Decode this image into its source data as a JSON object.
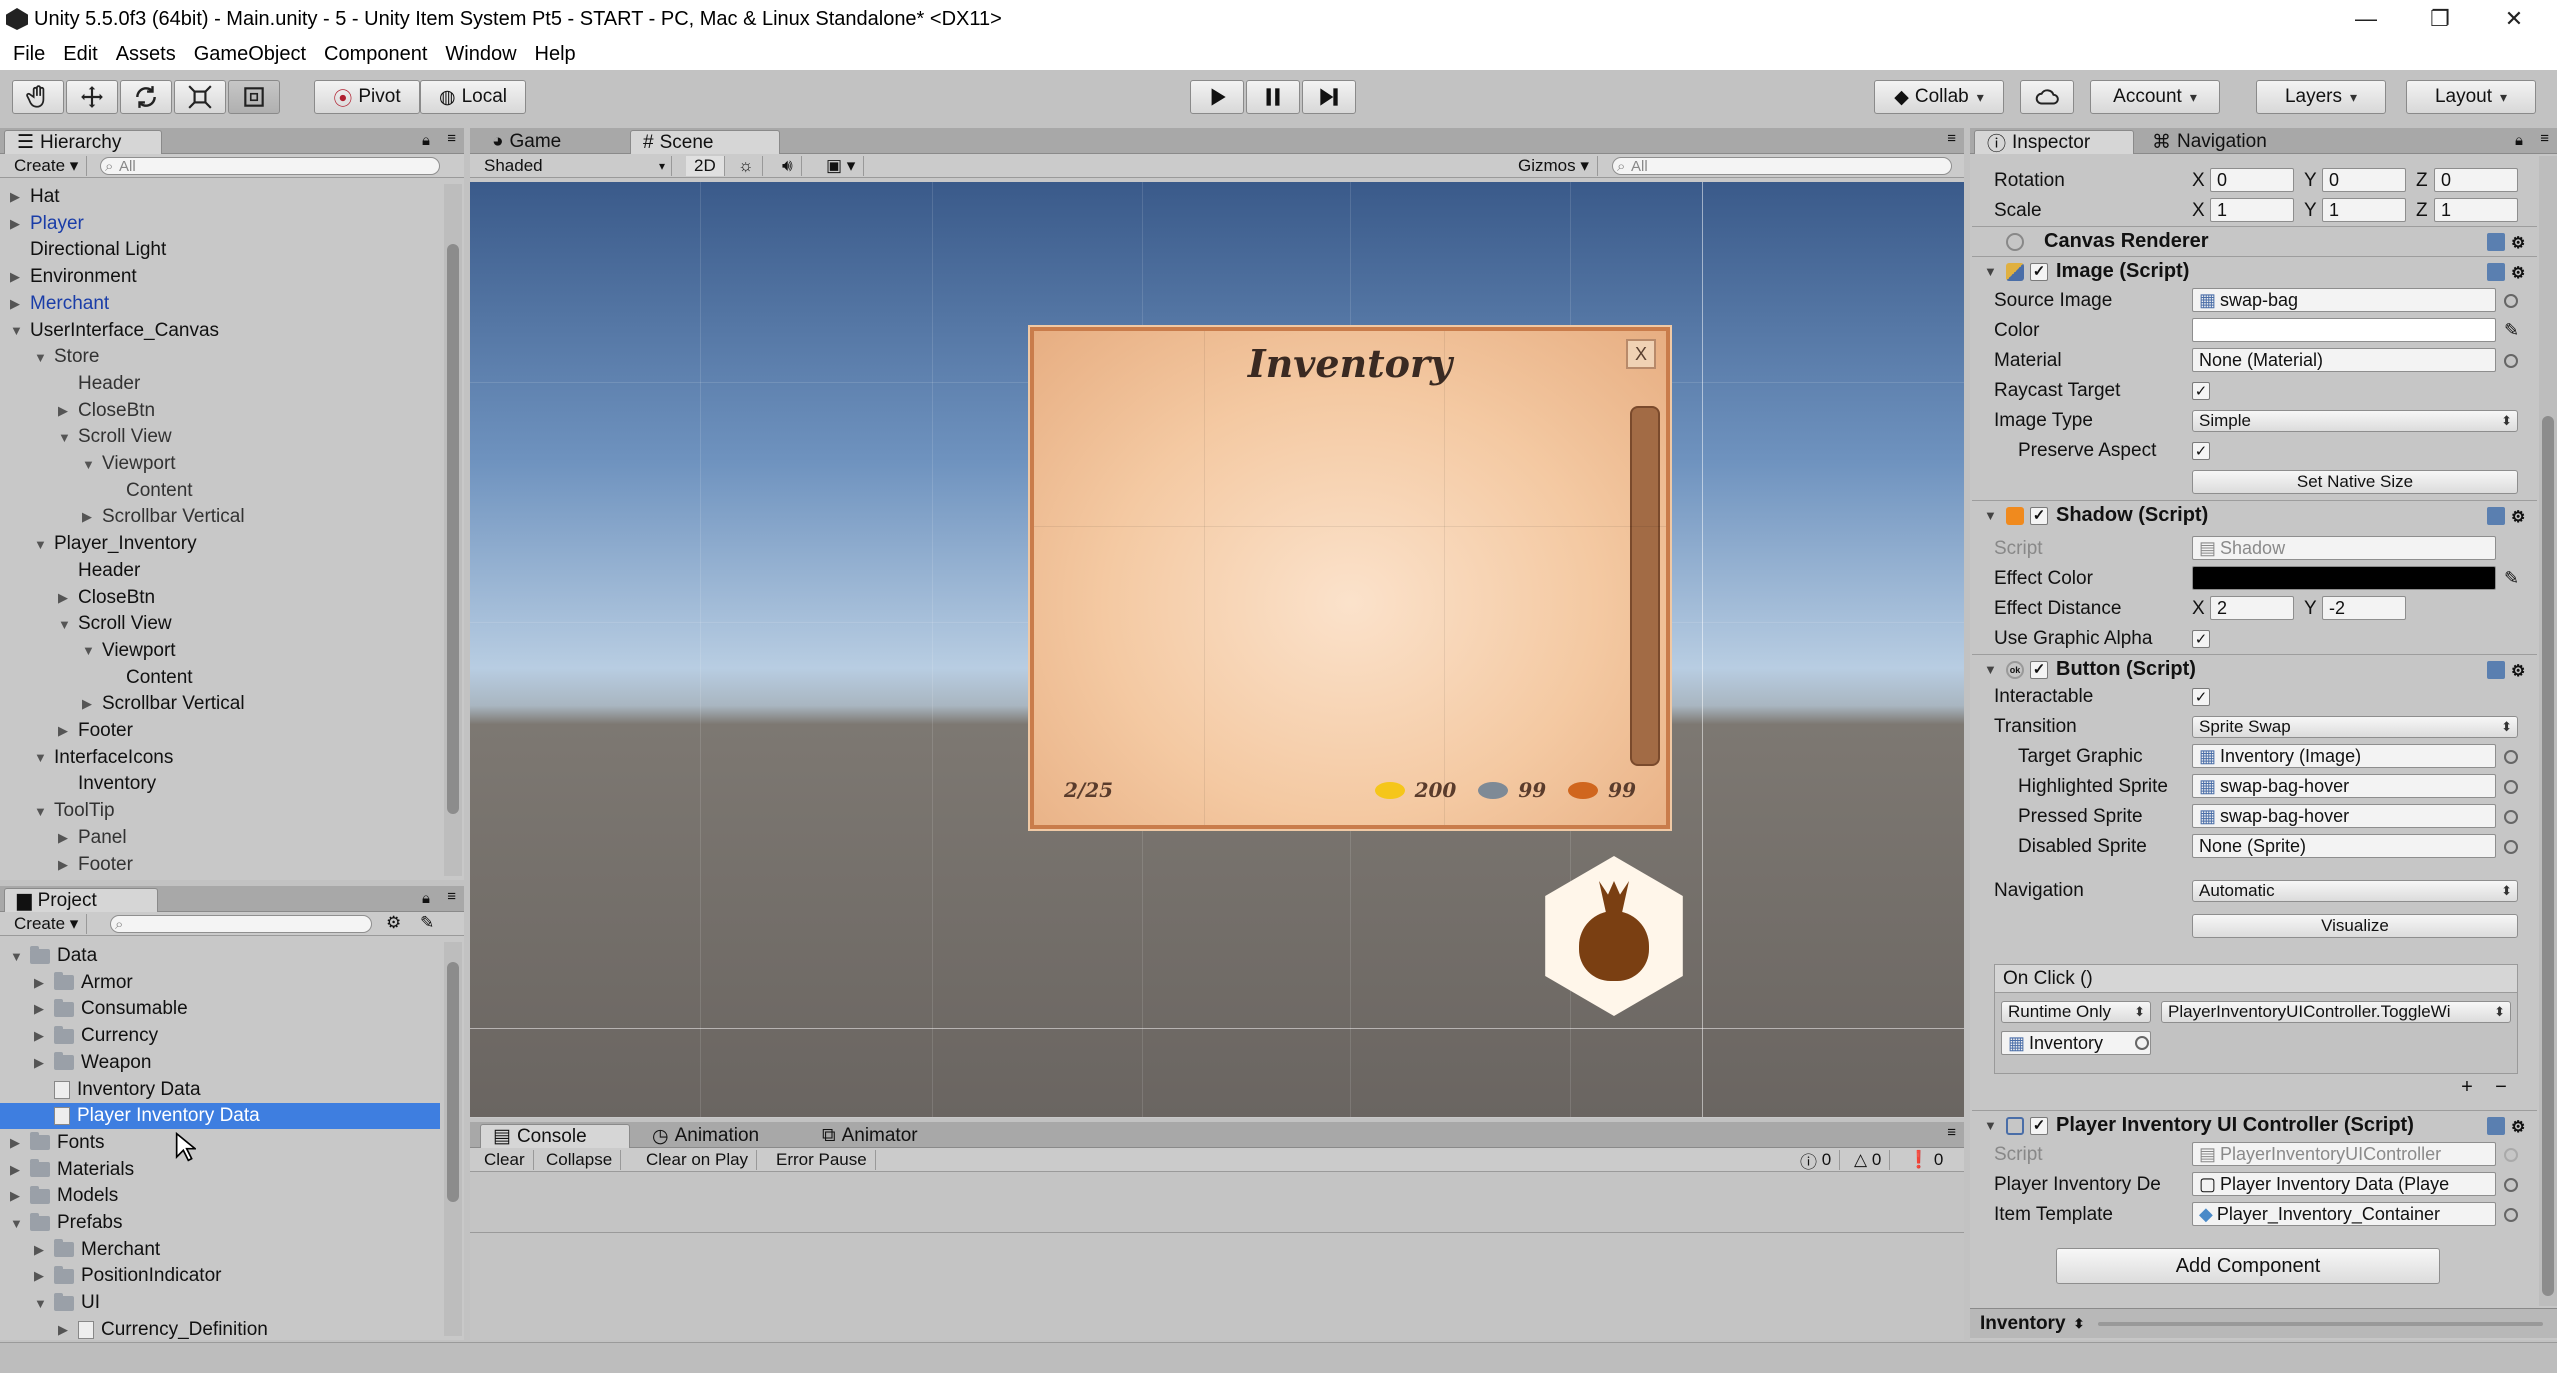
{
  "titlebar": {
    "title": "Unity 5.5.0f3 (64bit) - Main.unity - 5 - Unity Item System Pt5 - START - PC, Mac & Linux Standalone* <DX11>"
  },
  "menu": [
    "File",
    "Edit",
    "Assets",
    "GameObject",
    "Component",
    "Window",
    "Help"
  ],
  "toolbar": {
    "pivot": "Pivot",
    "local": "Local",
    "collab": "Collab",
    "account": "Account",
    "layers": "Layers",
    "layout": "Layout"
  },
  "hierarchy": {
    "tab": "Hierarchy",
    "create": "Create",
    "search": "All",
    "items": [
      {
        "label": "Hat",
        "indent": 0,
        "arrow": "right",
        "color": "black"
      },
      {
        "label": "Player",
        "indent": 0,
        "arrow": "right",
        "color": "blue"
      },
      {
        "label": "Directional Light",
        "indent": 0,
        "arrow": "",
        "color": "black"
      },
      {
        "label": "Environment",
        "indent": 0,
        "arrow": "right",
        "color": "black"
      },
      {
        "label": "Merchant",
        "indent": 0,
        "arrow": "right",
        "color": "blue"
      },
      {
        "label": "UserInterface_Canvas",
        "indent": 0,
        "arrow": "down",
        "color": "black"
      },
      {
        "label": "Store",
        "indent": 1,
        "arrow": "down",
        "color": "grey"
      },
      {
        "label": "Header",
        "indent": 2,
        "arrow": "",
        "color": "grey"
      },
      {
        "label": "CloseBtn",
        "indent": 2,
        "arrow": "right",
        "color": "grey"
      },
      {
        "label": "Scroll View",
        "indent": 2,
        "arrow": "down",
        "color": "grey"
      },
      {
        "label": "Viewport",
        "indent": 3,
        "arrow": "down",
        "color": "grey"
      },
      {
        "label": "Content",
        "indent": 4,
        "arrow": "",
        "color": "grey"
      },
      {
        "label": "Scrollbar Vertical",
        "indent": 3,
        "arrow": "right",
        "color": "grey"
      },
      {
        "label": "Player_Inventory",
        "indent": 1,
        "arrow": "down",
        "color": "black"
      },
      {
        "label": "Header",
        "indent": 2,
        "arrow": "",
        "color": "black"
      },
      {
        "label": "CloseBtn",
        "indent": 2,
        "arrow": "right",
        "color": "black"
      },
      {
        "label": "Scroll View",
        "indent": 2,
        "arrow": "down",
        "color": "black"
      },
      {
        "label": "Viewport",
        "indent": 3,
        "arrow": "down",
        "color": "black"
      },
      {
        "label": "Content",
        "indent": 4,
        "arrow": "",
        "color": "black"
      },
      {
        "label": "Scrollbar Vertical",
        "indent": 3,
        "arrow": "right",
        "color": "black"
      },
      {
        "label": "Footer",
        "indent": 2,
        "arrow": "right",
        "color": "black"
      },
      {
        "label": "InterfaceIcons",
        "indent": 1,
        "arrow": "down",
        "color": "black"
      },
      {
        "label": "Inventory",
        "indent": 2,
        "arrow": "",
        "color": "black"
      },
      {
        "label": "ToolTip",
        "indent": 1,
        "arrow": "down",
        "color": "grey"
      },
      {
        "label": "Panel",
        "indent": 2,
        "arrow": "right",
        "color": "grey"
      },
      {
        "label": "Footer",
        "indent": 2,
        "arrow": "right",
        "color": "grey"
      }
    ]
  },
  "project": {
    "tab": "Project",
    "create": "Create",
    "items": [
      {
        "label": "Data",
        "indent": 0,
        "arrow": "down",
        "type": "folder"
      },
      {
        "label": "Armor",
        "indent": 1,
        "arrow": "right",
        "type": "folder"
      },
      {
        "label": "Consumable",
        "indent": 1,
        "arrow": "right",
        "type": "folder"
      },
      {
        "label": "Currency",
        "indent": 1,
        "arrow": "right",
        "type": "folder"
      },
      {
        "label": "Weapon",
        "indent": 1,
        "arrow": "right",
        "type": "folder"
      },
      {
        "label": "Inventory Data",
        "indent": 1,
        "arrow": "",
        "type": "asset"
      },
      {
        "label": "Player Inventory Data",
        "indent": 1,
        "arrow": "",
        "type": "asset",
        "selected": true
      },
      {
        "label": "Fonts",
        "indent": 0,
        "arrow": "right",
        "type": "folder"
      },
      {
        "label": "Materials",
        "indent": 0,
        "arrow": "right",
        "type": "folder"
      },
      {
        "label": "Models",
        "indent": 0,
        "arrow": "right",
        "type": "folder"
      },
      {
        "label": "Prefabs",
        "indent": 0,
        "arrow": "down",
        "type": "folder"
      },
      {
        "label": "Merchant",
        "indent": 1,
        "arrow": "right",
        "type": "folder"
      },
      {
        "label": "PositionIndicator",
        "indent": 1,
        "arrow": "right",
        "type": "folder"
      },
      {
        "label": "UI",
        "indent": 1,
        "arrow": "down",
        "type": "folder"
      },
      {
        "label": "Currency_Definition",
        "indent": 2,
        "arrow": "right",
        "type": "asset"
      }
    ]
  },
  "scene": {
    "tabs": [
      "Game",
      "Scene"
    ],
    "shading": "Shaded",
    "mode2d": "2D",
    "gizmos": "Gizmos",
    "search": "All",
    "inventory": {
      "title": "Inventory",
      "close": "X",
      "slots": "2/25",
      "gold": "200",
      "silver": "99",
      "copper": "99"
    }
  },
  "console": {
    "tabs": [
      "Console",
      "Animation",
      "Animator"
    ],
    "buttons": [
      "Clear",
      "Collapse",
      "Clear on Play",
      "Error Pause"
    ],
    "counts": [
      "0",
      "0",
      "0"
    ]
  },
  "inspector": {
    "tabs": [
      "Inspector",
      "Navigation"
    ],
    "transform": {
      "rotation_label": "Rotation",
      "scale_label": "Scale",
      "rotation": [
        "0",
        "0",
        "0"
      ],
      "scale": [
        "1",
        "1",
        "1"
      ],
      "axis": [
        "X",
        "Y",
        "Z"
      ]
    },
    "canvas_renderer": "Canvas Renderer",
    "image": {
      "header": "Image (Script)",
      "source_image_label": "Source Image",
      "source_image": "swap-bag",
      "color_label": "Color",
      "material_label": "Material",
      "material": "None (Material)",
      "raycast_label": "Raycast Target",
      "image_type_label": "Image Type",
      "image_type": "Simple",
      "preserve_label": "Preserve Aspect",
      "set_native": "Set Native Size"
    },
    "shadow": {
      "header": "Shadow (Script)",
      "script_label": "Script",
      "script": "Shadow",
      "effect_color_label": "Effect Color",
      "effect_distance_label": "Effect Distance",
      "dist_x": "2",
      "dist_y": "-2",
      "use_alpha_label": "Use Graphic Alpha"
    },
    "button": {
      "header": "Button (Script)",
      "interactable_label": "Interactable",
      "transition_label": "Transition",
      "transition": "Sprite Swap",
      "target_graphic_label": "Target Graphic",
      "target_graphic": "Inventory (Image)",
      "highlighted_label": "Highlighted Sprite",
      "highlighted": "swap-bag-hover",
      "pressed_label": "Pressed Sprite",
      "pressed": "swap-bag-hover",
      "disabled_label": "Disabled Sprite",
      "disabled": "None (Sprite)",
      "navigation_label": "Navigation",
      "navigation": "Automatic",
      "visualize": "Visualize",
      "onclick": "On Click ()",
      "runtime": "Runtime Only",
      "function": "PlayerInventoryUIController.ToggleWi",
      "object": "Inventory",
      "plus": "+",
      "minus": "−"
    },
    "controller": {
      "header": "Player Inventory UI Controller (Script)",
      "script_label": "Script",
      "script": "PlayerInventoryUIController",
      "data_label": "Player Inventory De",
      "data": "Player Inventory Data (Playe",
      "template_label": "Item Template",
      "template": "Player_Inventory_Container"
    },
    "add_component": "Add Component",
    "preview": "Inventory"
  },
  "colors": {
    "accent": "#3e7ee0",
    "panel": "#c2c2c2",
    "prefab_blue": "#1a3da8"
  }
}
